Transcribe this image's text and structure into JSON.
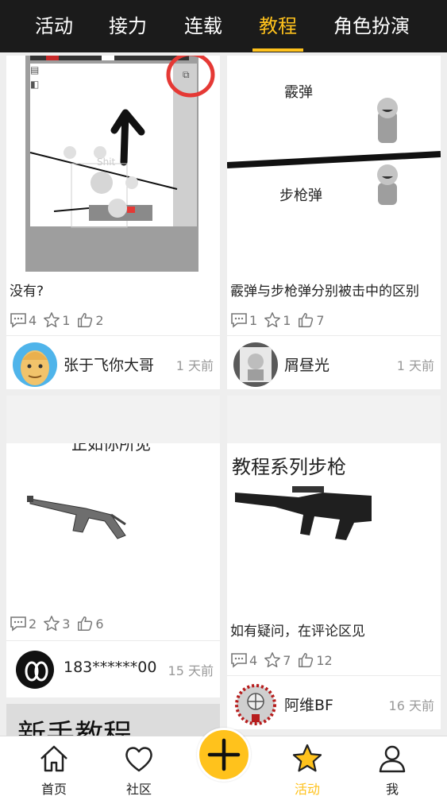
{
  "tabs": [
    {
      "label": "活动"
    },
    {
      "label": "接力"
    },
    {
      "label": "连载"
    },
    {
      "label": "教程"
    },
    {
      "label": "角色扮演"
    }
  ],
  "active_tab": "教程",
  "colors": {
    "accent": "#ffc21c",
    "topbar": "#1b1b1b",
    "background": "#eeeeee"
  },
  "posts": [
    {
      "title": "没有?",
      "thumb_text": "Shit",
      "comments": "4",
      "favorites": "1",
      "likes": "2",
      "author": "张于飞你大哥",
      "time": "1 天前"
    },
    {
      "title": "霰弹与步枪弹分别被击中的区别",
      "thumb_label_top": "霰弹",
      "thumb_label_bottom": "步枪弹",
      "comments": "1",
      "favorites": "1",
      "likes": "7",
      "author": "屑昼光",
      "time": "1 天前"
    },
    {
      "title": "",
      "thumb_text": "正如你所见",
      "comments": "2",
      "favorites": "3",
      "likes": "6",
      "author": "183******00",
      "time": "15 天前"
    },
    {
      "title": "如有疑问，在评论区见",
      "thumb_text": "教程系列步枪",
      "comments": "4",
      "favorites": "7",
      "likes": "12",
      "author": "阿维BF",
      "time": "16 天前"
    },
    {
      "thumb_text": "新手教程"
    }
  ],
  "bottom_nav": [
    {
      "label": "首页",
      "icon": "home-icon"
    },
    {
      "label": "社区",
      "icon": "heart-icon"
    },
    {
      "label": "",
      "icon": "plus-icon"
    },
    {
      "label": "活动",
      "icon": "star-icon"
    },
    {
      "label": "我",
      "icon": "user-icon"
    }
  ]
}
